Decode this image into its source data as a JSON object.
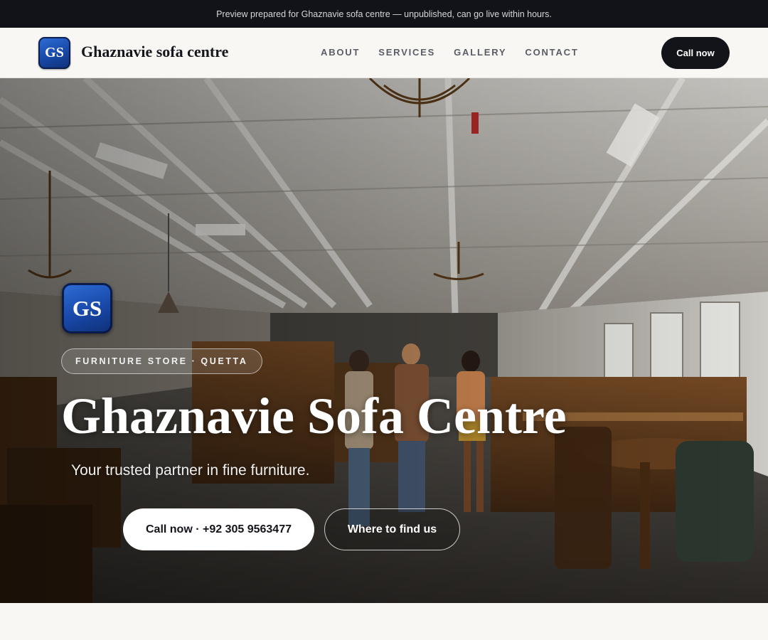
{
  "banner": {
    "text": "Preview prepared for Ghaznavie sofa centre — unpublished, can go live within hours."
  },
  "header": {
    "logo_text": "GS",
    "brand": "Ghaznavie sofa centre",
    "nav": [
      {
        "label": "ABOUT"
      },
      {
        "label": "SERVICES"
      },
      {
        "label": "GALLERY"
      },
      {
        "label": "CONTACT"
      }
    ],
    "cta": "Call now"
  },
  "hero": {
    "logo_text": "GS",
    "tag": "FURNITURE STORE · QUETTA",
    "title": "Ghaznavie Sofa Centre",
    "subtitle": "Your trusted partner in fine furniture.",
    "primary_button": "Call now · +92 305 9563477",
    "secondary_button": "Where to find us",
    "background_image": "furniture-showroom-photo"
  },
  "colors": {
    "dark": "#111318",
    "accent_blue": "#1848a8",
    "page_bg": "#f8f7f4",
    "white": "#ffffff"
  }
}
